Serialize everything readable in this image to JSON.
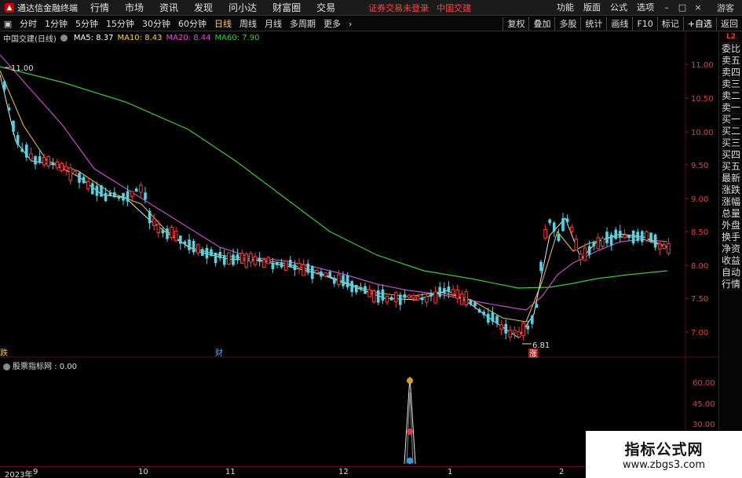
{
  "menubar": {
    "logo_text": "通达信金融终端",
    "items": [
      "行情",
      "市场",
      "资讯",
      "发现",
      "问小达",
      "财富圈",
      "交易"
    ],
    "warning": "证券交易未登录",
    "stock": "中国交建",
    "right_items": [
      "功能",
      "版面",
      "公式",
      "选项"
    ],
    "guest": "游客"
  },
  "toolbar": {
    "periods": [
      "分时",
      "1分钟",
      "5分钟",
      "15分钟",
      "30分钟",
      "60分钟",
      "日线",
      "周线",
      "月线",
      "多周期",
      "更多"
    ],
    "active_period": "日线",
    "buttons": [
      "复权",
      "叠加",
      "多股",
      "统计",
      "画线",
      "F10",
      "标记",
      "+自选",
      "返回"
    ]
  },
  "info": {
    "name": "中国交建(日线)",
    "ma5": "MA5: 8.37",
    "ma10": "MA10: 8.43",
    "ma20": "MA20: 8.44",
    "ma60": "MA60: 7.90",
    "colors": {
      "ma5": "#ffffff",
      "ma10": "#ffd23a",
      "ma20": "#e04de0",
      "ma60": "#3cc83c"
    }
  },
  "sidebar": {
    "top_label": "L2",
    "items": [
      "委比",
      "卖五",
      "卖四",
      "卖三",
      "卖二",
      "卖一",
      "买一",
      "买二",
      "买三",
      "买四",
      "买五",
      "最新",
      "涨跌",
      "涨幅",
      "总量",
      "外盘",
      "换手",
      "净资",
      "收益",
      "自动",
      "行情"
    ]
  },
  "price_axis": [
    "11.00",
    "10.50",
    "10.00",
    "9.50",
    "9.00",
    "8.50",
    "8.00",
    "7.50",
    "7.00"
  ],
  "annotations": {
    "high": "11.00",
    "low": "6.81",
    "mark_left": "跌",
    "mark_fin": "财",
    "mark_rise": "涨"
  },
  "indicator": {
    "title": "股票指标网 : 0.00",
    "axis": [
      "60.00",
      "45.00",
      "30.00"
    ]
  },
  "dates": [
    "2023年",
    "9",
    "10",
    "11",
    "12",
    "1",
    "2"
  ],
  "watermark": {
    "title": "指标公式网",
    "url": "www.zbgs3.com"
  }
}
